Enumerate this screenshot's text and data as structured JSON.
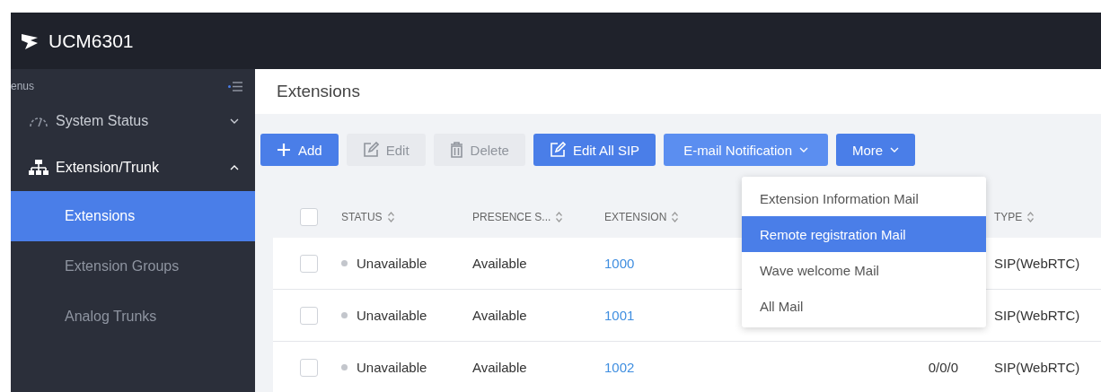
{
  "header": {
    "title": "UCM6301"
  },
  "sidebar": {
    "label": "enus",
    "items": [
      {
        "label": "System Status",
        "kind": "group",
        "expanded": false,
        "selected": false
      },
      {
        "label": "Extension/Trunk",
        "kind": "group",
        "expanded": true,
        "selected": false
      },
      {
        "label": "Extensions",
        "kind": "sub",
        "selected": true
      },
      {
        "label": "Extension Groups",
        "kind": "sub",
        "selected": false
      },
      {
        "label": "Analog Trunks",
        "kind": "sub",
        "selected": false
      }
    ]
  },
  "page": {
    "title": "Extensions"
  },
  "toolbar": [
    {
      "label": "Add",
      "kind": "add",
      "disabled": false,
      "open": false
    },
    {
      "label": "Edit",
      "kind": "edit",
      "disabled": true,
      "open": false
    },
    {
      "label": "Delete",
      "kind": "delete",
      "disabled": true,
      "open": false
    },
    {
      "label": "Edit All SIP",
      "kind": "edit",
      "disabled": false,
      "open": false
    },
    {
      "label": "E-mail Notification",
      "kind": "dropdown",
      "disabled": false,
      "open": true
    },
    {
      "label": "More",
      "kind": "dropdown",
      "disabled": false,
      "open": false
    }
  ],
  "dropdown_menu": [
    {
      "label": "Extension Information Mail",
      "selected": false
    },
    {
      "label": "Remote registration Mail",
      "selected": true
    },
    {
      "label": "Wave welcome Mail",
      "selected": false
    },
    {
      "label": "All Mail",
      "selected": false
    }
  ],
  "table": {
    "select_all_checked": false,
    "columns": [
      "STATUS",
      "PRESENCE S...",
      "EXTENSION",
      "TYPE"
    ],
    "rows": [
      {
        "checked": false,
        "status": "Unavailable",
        "presence": "Available",
        "extension": "1000",
        "type": "SIP(WebRTC)"
      },
      {
        "checked": false,
        "status": "Unavailable",
        "presence": "Available",
        "extension": "1001",
        "type": "SIP(WebRTC)"
      },
      {
        "checked": false,
        "status": "Unavailable",
        "presence": "Available",
        "extension": "1002",
        "column_4": "0/0/0",
        "type": "SIP(WebRTC)"
      }
    ]
  }
}
